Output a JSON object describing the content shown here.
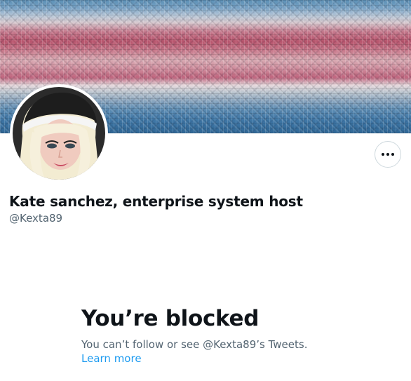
{
  "profile": {
    "display_name": "Kate sanchez, enterprise system host",
    "handle": "@Kexta89"
  },
  "blocked": {
    "title": "You’re blocked",
    "message": "You can’t follow or see @Kexta89’s Tweets.",
    "link_label": "Learn more"
  },
  "icons": {
    "more": "more-horizontal-icon"
  },
  "colors": {
    "link": "#1d9bf0",
    "secondary_text": "#536471",
    "primary_text": "#0f1419",
    "border": "#cfd9de"
  }
}
